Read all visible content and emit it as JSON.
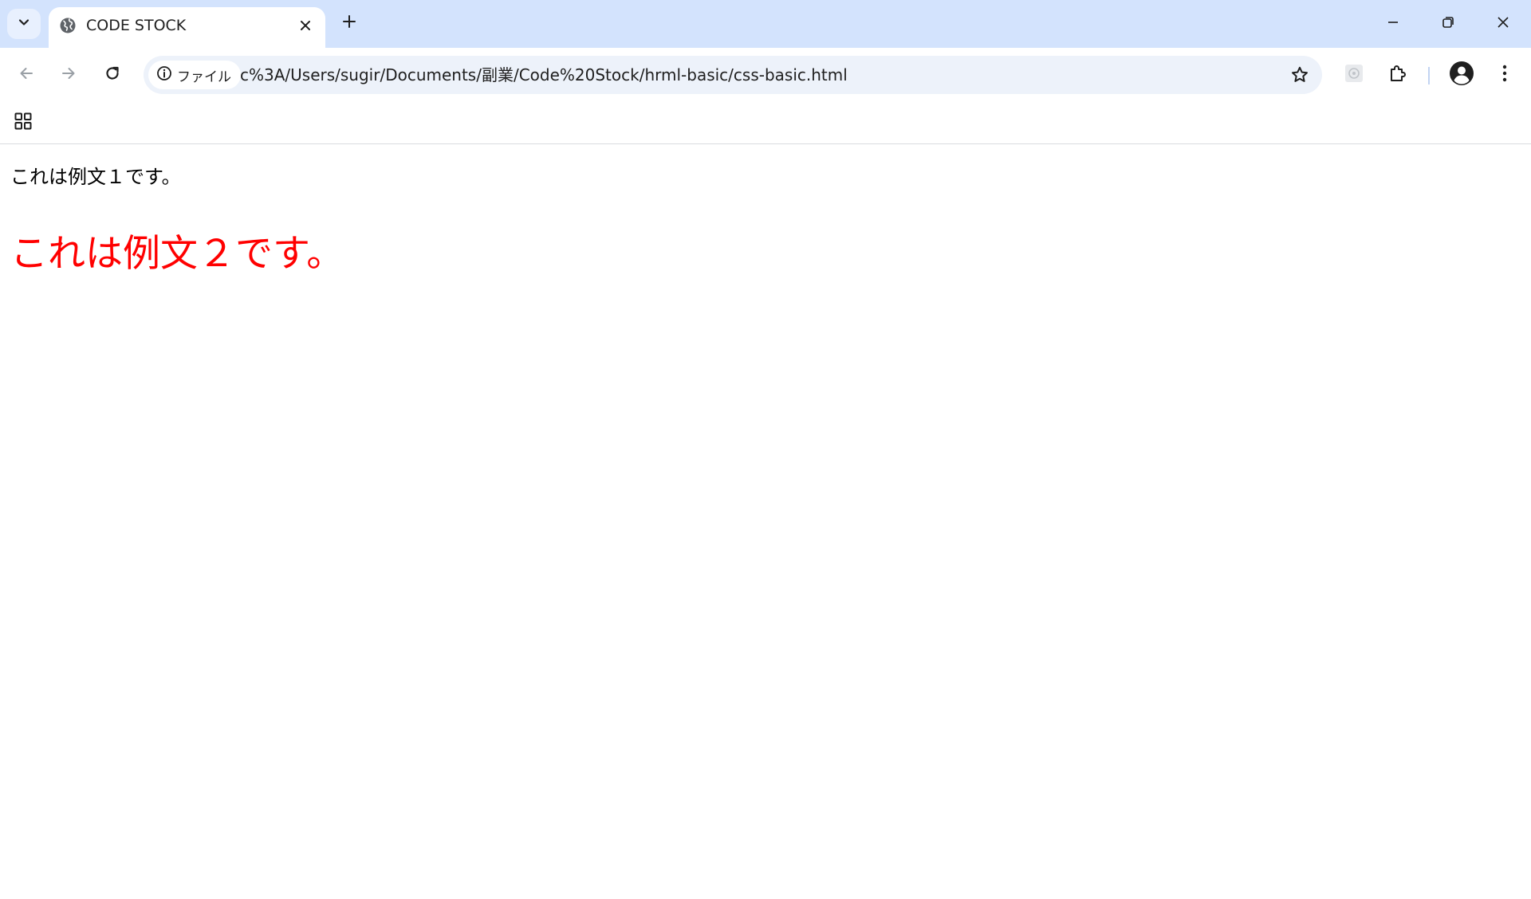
{
  "window": {
    "tab_title": "CODE STOCK"
  },
  "toolbar": {
    "site_chip_label": "ファイル",
    "url": "c%3A/Users/sugir/Documents/副業/Code%20Stock/hrml-basic/css-basic.html"
  },
  "icons": {
    "tab_search": "chevron-down-icon",
    "favicon": "globe-icon",
    "tab_close": "close-icon",
    "new_tab": "plus-icon",
    "minimize": "minimize-icon",
    "restore": "restore-icon",
    "close_window": "close-icon",
    "back": "arrow-left-icon",
    "forward": "arrow-right-icon",
    "reload": "reload-icon",
    "site_info": "info-icon",
    "bookmark": "star-icon",
    "extension": "extension-icon",
    "extensions_menu": "puzzle-icon",
    "profile": "account-circle-icon",
    "menu": "kebab-menu-icon",
    "apps": "apps-grid-icon"
  },
  "page": {
    "sentence1": "これは例文１です。",
    "sentence2": "これは例文２です。",
    "sentence1_color": "#000000",
    "sentence2_color": "#ff0000"
  },
  "colors": {
    "tabstrip_bg": "#d3e3fd",
    "omnibox_bg": "#edf2fa"
  }
}
